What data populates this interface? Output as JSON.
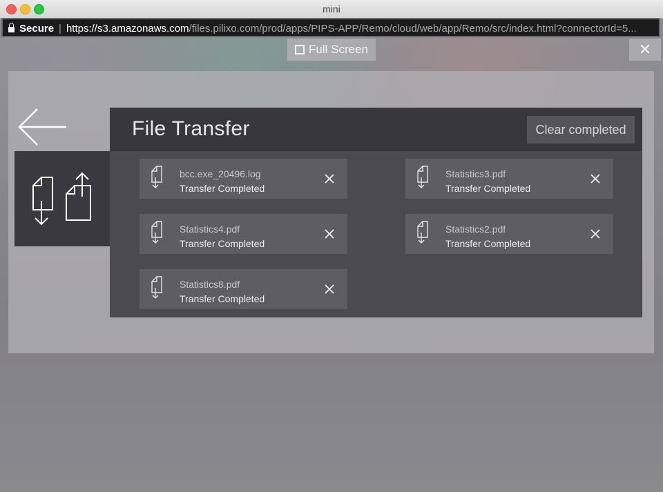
{
  "window": {
    "title": "mini"
  },
  "urlbar": {
    "secure_label": "Secure",
    "url_host": "https://s3.amazonaws.com",
    "url_path": "/files.pilixo.com/prod/apps/PIPS-APP/Remo/cloud/web/app/Remo/src/index.html?connectorId=5..."
  },
  "overlay": {
    "fullscreen_label": "Full Screen",
    "close_label": "✕"
  },
  "file_transfer": {
    "title": "File Transfer",
    "clear_label": "Clear completed",
    "transfers": [
      {
        "name": "bcc.exe_20496.log",
        "status": "Transfer Completed"
      },
      {
        "name": "Statistics3.pdf",
        "status": "Transfer Completed"
      },
      {
        "name": "Statistics4.pdf",
        "status": "Transfer Completed"
      },
      {
        "name": "Statistics2.pdf",
        "status": "Transfer Completed"
      },
      {
        "name": "Statistics8.pdf",
        "status": "Transfer Completed"
      }
    ]
  },
  "colors": {
    "panel_dark": "#4b4a50",
    "header_dark": "#38373d",
    "card": "#5e5d63"
  }
}
